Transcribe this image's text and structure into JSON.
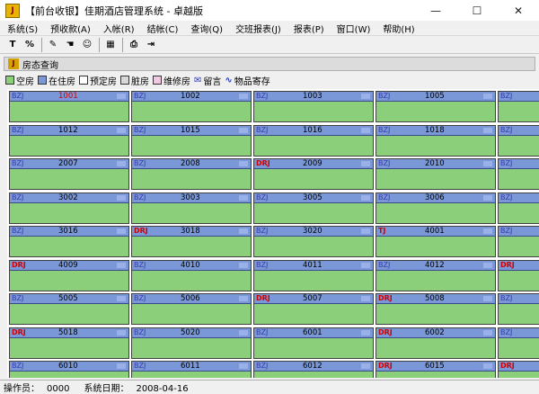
{
  "window": {
    "title": "【前台收银】佳期酒店管理系统 - 卓越版",
    "icon_label": "J",
    "controls": [
      "minimize-icon",
      "maximize-icon",
      "close-icon"
    ]
  },
  "menu": [
    {
      "label": "系统(S)"
    },
    {
      "label": "预收款(A)"
    },
    {
      "label": "入帐(R)"
    },
    {
      "label": "结帐(C)"
    },
    {
      "label": "查询(Q)"
    },
    {
      "label": "交班报表(J)"
    },
    {
      "label": "报表(P)"
    },
    {
      "label": "窗口(W)"
    },
    {
      "label": "帮助(H)"
    }
  ],
  "toolbar": {
    "buttons": [
      {
        "name": "filter-icon",
        "glyph": "T"
      },
      {
        "name": "percent-icon",
        "glyph": "%"
      },
      {
        "name": "edit-icon",
        "glyph": "✎"
      },
      {
        "name": "hand-icon",
        "glyph": "☚"
      },
      {
        "name": "user-add-icon",
        "glyph": "☺"
      },
      {
        "name": "grid-icon",
        "glyph": "▦"
      },
      {
        "name": "print-icon",
        "glyph": "⎙"
      },
      {
        "name": "exit-icon",
        "glyph": "⇥"
      }
    ]
  },
  "panel": {
    "title": "房态查询"
  },
  "legend": [
    {
      "label": "空房",
      "color": "#8ccf7a"
    },
    {
      "label": "在住房",
      "color": "#7a98d8"
    },
    {
      "label": "预定房",
      "color": "#ffffff"
    },
    {
      "label": "脏房",
      "color": "#d8d8d8"
    },
    {
      "label": "维修房",
      "color": "#f0c8e0"
    },
    {
      "label": "留言",
      "icon": "✉"
    },
    {
      "label": "物品寄存",
      "icon": "∿"
    }
  ],
  "rooms": [
    [
      "1001",
      "BZJ"
    ],
    [
      "1002",
      "BZJ"
    ],
    [
      "1003",
      "BZJ"
    ],
    [
      "1005",
      "BZJ"
    ],
    [
      "",
      "BZJ"
    ],
    [
      "1012",
      "BZJ"
    ],
    [
      "1015",
      "BZJ"
    ],
    [
      "1016",
      "BZJ"
    ],
    [
      "1018",
      "BZJ"
    ],
    [
      "",
      "BZJ"
    ],
    [
      "2007",
      "BZJ"
    ],
    [
      "2008",
      "BZJ"
    ],
    [
      "2009",
      "DRJ"
    ],
    [
      "2010",
      "BZJ"
    ],
    [
      "",
      "BZJ"
    ],
    [
      "3002",
      "BZJ"
    ],
    [
      "3003",
      "BZJ"
    ],
    [
      "3005",
      "BZJ"
    ],
    [
      "3006",
      "BZJ"
    ],
    [
      "",
      "BZJ"
    ],
    [
      "3016",
      "BZJ"
    ],
    [
      "3018",
      "DRJ"
    ],
    [
      "3020",
      "BZJ"
    ],
    [
      "4001",
      "TJ"
    ],
    [
      "",
      "BZJ"
    ],
    [
      "4009",
      "DRJ"
    ],
    [
      "4010",
      "BZJ"
    ],
    [
      "4011",
      "BZJ"
    ],
    [
      "4012",
      "BZJ"
    ],
    [
      "",
      "DRJ"
    ],
    [
      "5005",
      "BZJ"
    ],
    [
      "5006",
      "BZJ"
    ],
    [
      "5007",
      "DRJ"
    ],
    [
      "5008",
      "DRJ"
    ],
    [
      "",
      "BZJ"
    ],
    [
      "5018",
      "DRJ"
    ],
    [
      "5020",
      "BZJ"
    ],
    [
      "6001",
      "BZJ"
    ],
    [
      "6002",
      "DRJ"
    ],
    [
      "",
      "BZJ"
    ],
    [
      "6010",
      "BZJ"
    ],
    [
      "6011",
      "BZJ"
    ],
    [
      "6012",
      "BZJ"
    ],
    [
      "6015",
      "DRJ"
    ],
    [
      "",
      "DRJ"
    ]
  ],
  "status": {
    "operator_label": "操作员：",
    "operator": "0000",
    "date_label": "系统日期：",
    "date": "2008-04-16"
  }
}
